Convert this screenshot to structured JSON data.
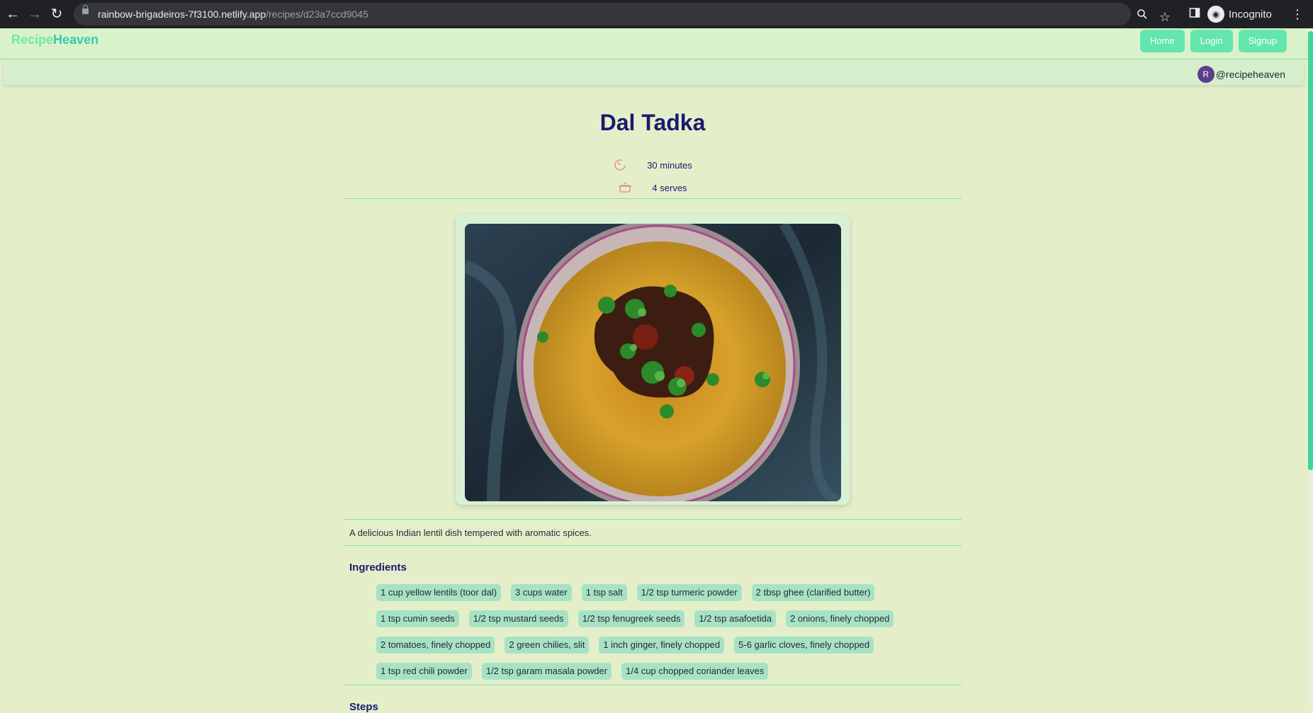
{
  "browser": {
    "url_host": "rainbow-brigadeiros-7f3100.netlify.app",
    "url_path": "/recipes/d23a7ccd9045",
    "profile_label": "Incognito"
  },
  "navbar": {
    "brand_part1": "Recipe",
    "brand_part2": "Heaven",
    "buttons": [
      "Home",
      "Login",
      "Signup"
    ]
  },
  "user": {
    "avatar_letter": "R",
    "handle": "@recipeheaven"
  },
  "recipe": {
    "title": "Dal Tadka",
    "time": "30 minutes",
    "serves": "4 serves",
    "description": "A delicious Indian lentil dish tempered with aromatic spices.",
    "ingredients_heading": "Ingredients",
    "ingredients": [
      [
        "1 cup yellow lentils (toor dal)",
        "3 cups water",
        "1 tsp salt",
        "1/2 tsp turmeric powder",
        "2 tbsp ghee (clarified butter)"
      ],
      [
        "1 tsp cumin seeds",
        "1/2 tsp mustard seeds",
        "1/2 tsp fenugreek seeds",
        "1/2 tsp asafoetida",
        "2 onions, finely chopped"
      ],
      [
        "2 tomatoes, finely chopped",
        "2 green chilies, slit",
        "1 inch ginger, finely chopped",
        "5-6 garlic cloves, finely chopped"
      ],
      [
        "1 tsp red chili powder",
        "1/2 tsp garam masala powder",
        "1/4 cup chopped coriander leaves"
      ]
    ],
    "steps_heading": "Steps"
  },
  "colors": {
    "page_bg": "#e4efca",
    "accent": "#62e6ad",
    "title": "#1a1a6e",
    "chip": "#a8e2c4"
  }
}
